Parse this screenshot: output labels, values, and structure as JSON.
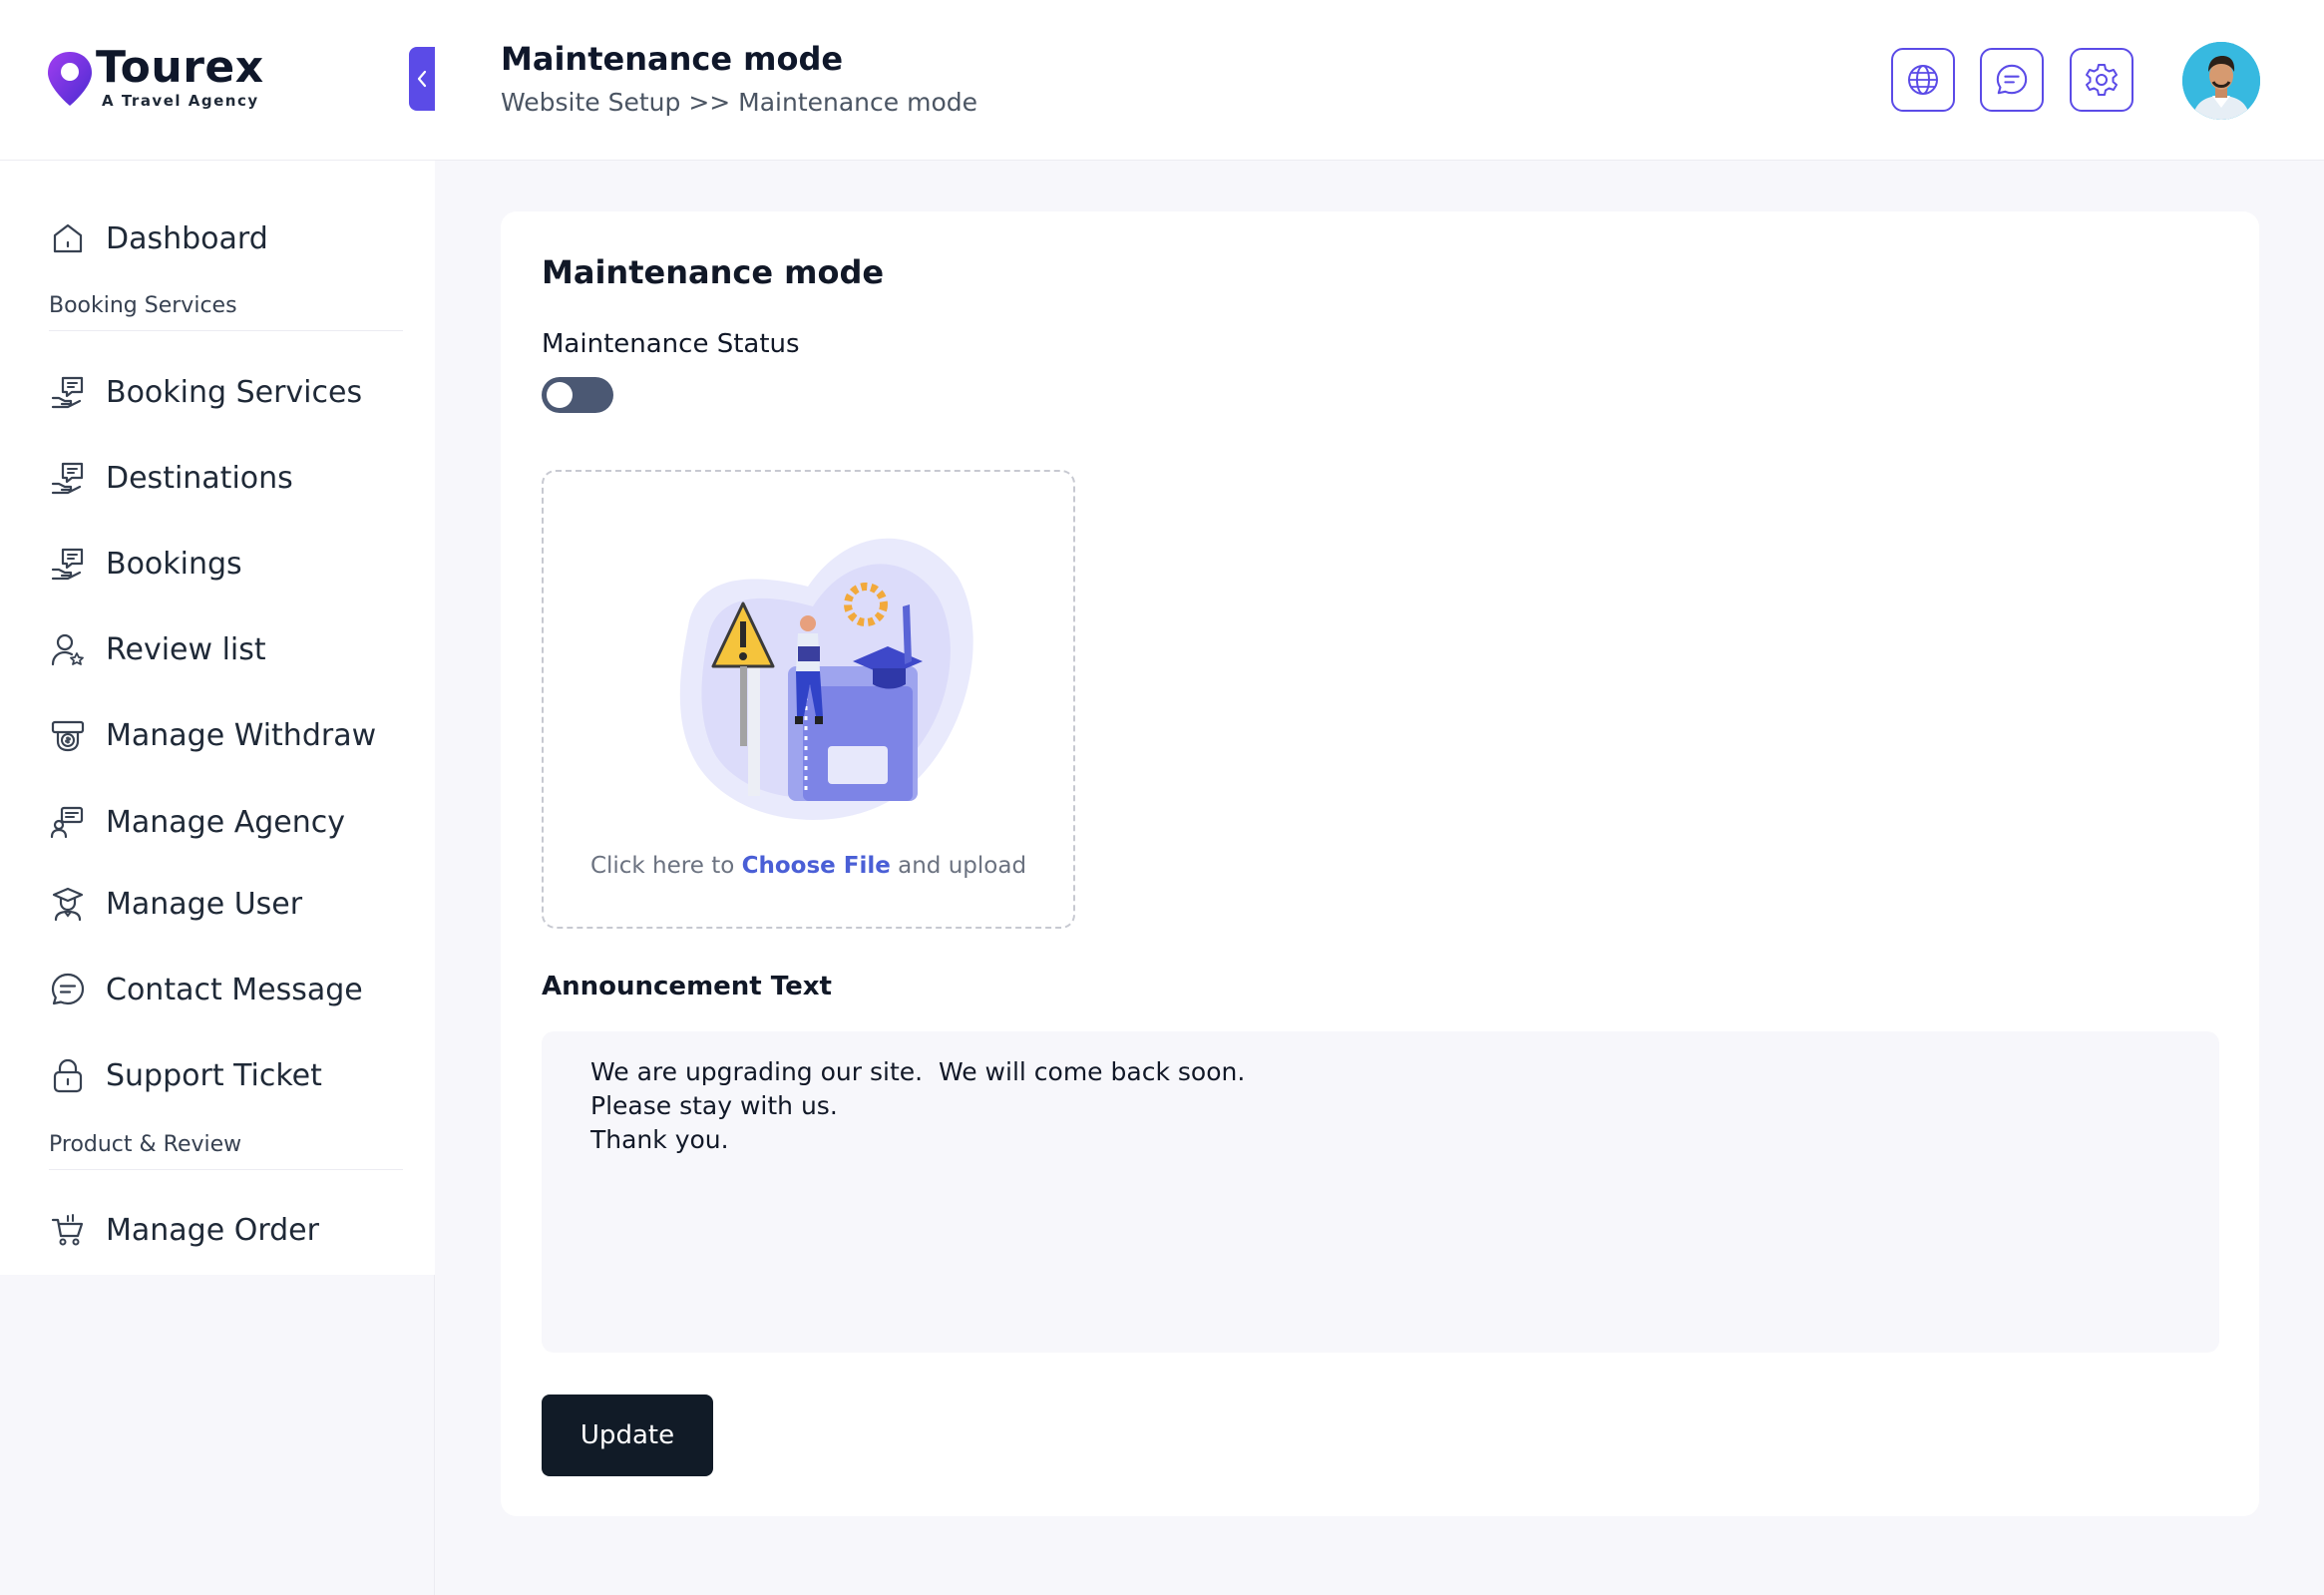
{
  "brand": {
    "name": "Tourex",
    "tagline": "A Travel Agency",
    "accent": "#5b4be7"
  },
  "sidebar": {
    "sections": [
      {
        "label": "Booking Services"
      },
      {
        "label": "Product & Review"
      }
    ],
    "items": [
      {
        "label": "Dashboard",
        "icon": "home-icon"
      },
      {
        "label": "Booking Services",
        "icon": "chat-hand-icon"
      },
      {
        "label": "Destinations",
        "icon": "chat-hand-icon"
      },
      {
        "label": "Bookings",
        "icon": "chat-hand-icon"
      },
      {
        "label": "Review list",
        "icon": "user-star-icon"
      },
      {
        "label": "Manage Withdraw",
        "icon": "money-icon"
      },
      {
        "label": "Manage Agency",
        "icon": "agency-icon"
      },
      {
        "label": "Manage User",
        "icon": "user-cap-icon"
      },
      {
        "label": "Contact Message",
        "icon": "message-icon"
      },
      {
        "label": "Support Ticket",
        "icon": "lock-icon"
      },
      {
        "label": "Manage Order",
        "icon": "basket-icon"
      }
    ]
  },
  "header": {
    "title": "Maintenance mode",
    "breadcrumb": "Website Setup >> Maintenance mode",
    "buttons": [
      "globe-icon",
      "message-icon",
      "gear-icon"
    ]
  },
  "main": {
    "card_title": "Maintenance mode",
    "status_label": "Maintenance Status",
    "status_on": false,
    "upload": {
      "hint_prefix": "Click here to ",
      "hint_link": "Choose File",
      "hint_suffix": " and upload"
    },
    "announcement_label": "Announcement Text",
    "announcement_value": "We are upgrading our site.  We will come back soon.\nPlease stay with us.\nThank you.",
    "update_label": "Update"
  }
}
